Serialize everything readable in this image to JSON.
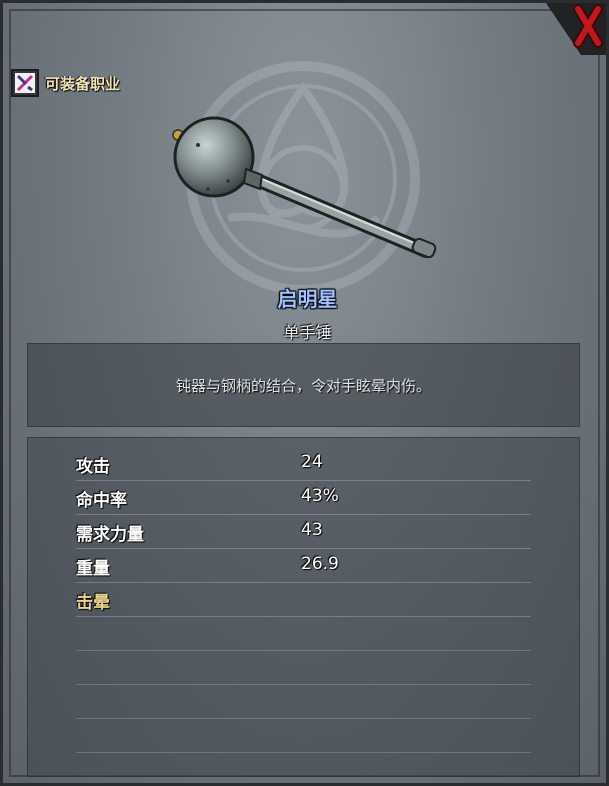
{
  "header": {
    "class_label": "可装备职业",
    "class_icon": "crossed-weapons-icon",
    "close_icon": "red-x-icon"
  },
  "item": {
    "name": "启明星",
    "type": "单手锤",
    "description": "钝器与钢柄的结合，令对手眩晕内伤。",
    "image_icon": "morning-star-mace-icon"
  },
  "stats": [
    {
      "label": "攻击",
      "value": "24"
    },
    {
      "label": "命中率",
      "value": "43%"
    },
    {
      "label": "需求力量",
      "value": "43"
    },
    {
      "label": "重量",
      "value": "26.9"
    }
  ],
  "special": {
    "label": "击晕"
  },
  "colors": {
    "item_name": "#9fc1ff",
    "special_label": "#e8d48a",
    "close": "#c0181c"
  }
}
